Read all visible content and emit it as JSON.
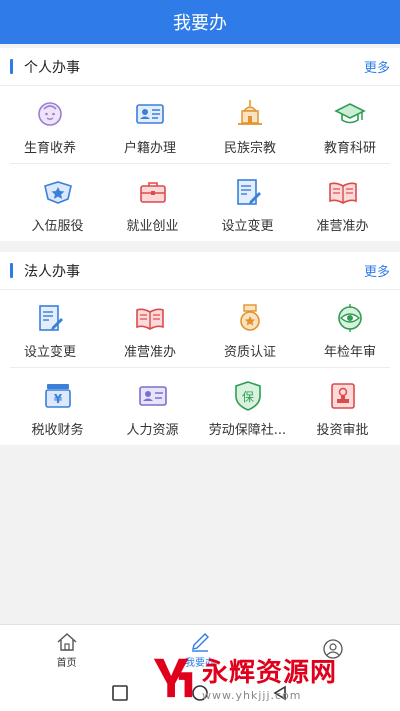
{
  "header": {
    "title": "我要办"
  },
  "personal": {
    "title": "个人办事",
    "more": "更多",
    "items": [
      {
        "label": "生育收养",
        "icon": "baby-icon"
      },
      {
        "label": "户籍办理",
        "icon": "id-card-icon"
      },
      {
        "label": "民族宗教",
        "icon": "temple-icon"
      },
      {
        "label": "教育科研",
        "icon": "graduation-cap-icon"
      },
      {
        "label": "入伍服役",
        "icon": "military-badge-icon"
      },
      {
        "label": "就业创业",
        "icon": "briefcase-icon"
      },
      {
        "label": "设立变更",
        "icon": "edit-document-icon"
      },
      {
        "label": "准营准办",
        "icon": "open-book-icon"
      }
    ]
  },
  "legal": {
    "title": "法人办事",
    "more": "更多",
    "items": [
      {
        "label": "设立变更",
        "icon": "edit-document-icon"
      },
      {
        "label": "准营准办",
        "icon": "open-book-icon"
      },
      {
        "label": "资质认证",
        "icon": "medal-icon"
      },
      {
        "label": "年检年审",
        "icon": "target-eye-icon"
      },
      {
        "label": "税收财务",
        "icon": "tax-money-icon"
      },
      {
        "label": "人力资源",
        "icon": "person-card-icon"
      },
      {
        "label": "劳动保障社...",
        "icon": "shield-guarantee-icon"
      },
      {
        "label": "投资审批",
        "icon": "approval-stamp-icon"
      }
    ],
    "shield_char": "保"
  },
  "nav": {
    "home": "首页",
    "todo": "我要办",
    "mine": ""
  },
  "watermark": {
    "brand": "永辉资源网",
    "url": "www.yhkjjj.com"
  },
  "colors": {
    "primary": "#2f7ce8",
    "orange": "#e8a33a",
    "green": "#3aae5a",
    "red": "#e0001b"
  }
}
